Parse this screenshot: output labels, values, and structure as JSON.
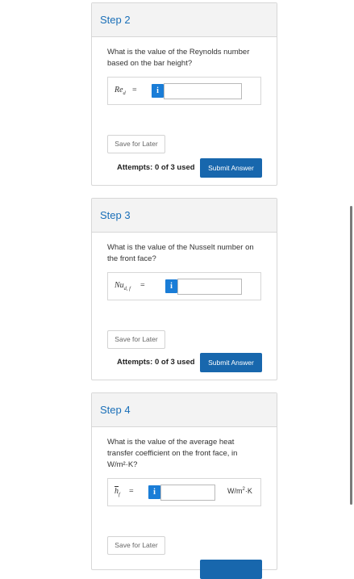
{
  "steps": [
    {
      "title": "Step 2",
      "question": "What is the value of the Reynolds number based on the bar height?",
      "variable": {
        "base": "Re",
        "sub": "d"
      },
      "equals": "=",
      "info_label": "i",
      "input_value": "",
      "save_label": "Save for Later",
      "attempts_label": "Attempts: 0 of 3 used",
      "submit_label": "Submit Answer"
    },
    {
      "title": "Step 3",
      "question": "What is the value of the Nusselt number on the front face?",
      "variable": {
        "base": "Nu",
        "sub": "d, f"
      },
      "equals": "=",
      "info_label": "i",
      "input_value": "",
      "save_label": "Save for Later",
      "attempts_label": "Attempts: 0 of 3 used",
      "submit_label": "Submit Answer"
    },
    {
      "title": "Step 4",
      "question": "What is the value of the average heat transfer coefficient on the front face, in W/m²·K?",
      "variable": {
        "base": "h",
        "sub": "f"
      },
      "equals": "=",
      "info_label": "i",
      "input_value": "",
      "unit": {
        "base": "W/m",
        "sup": "2",
        "rest": "·K"
      },
      "save_label": "Save for Later"
    }
  ],
  "colors": {
    "accent": "#1a6fb8",
    "submit": "#1867ad",
    "info": "#1a7dd7"
  }
}
